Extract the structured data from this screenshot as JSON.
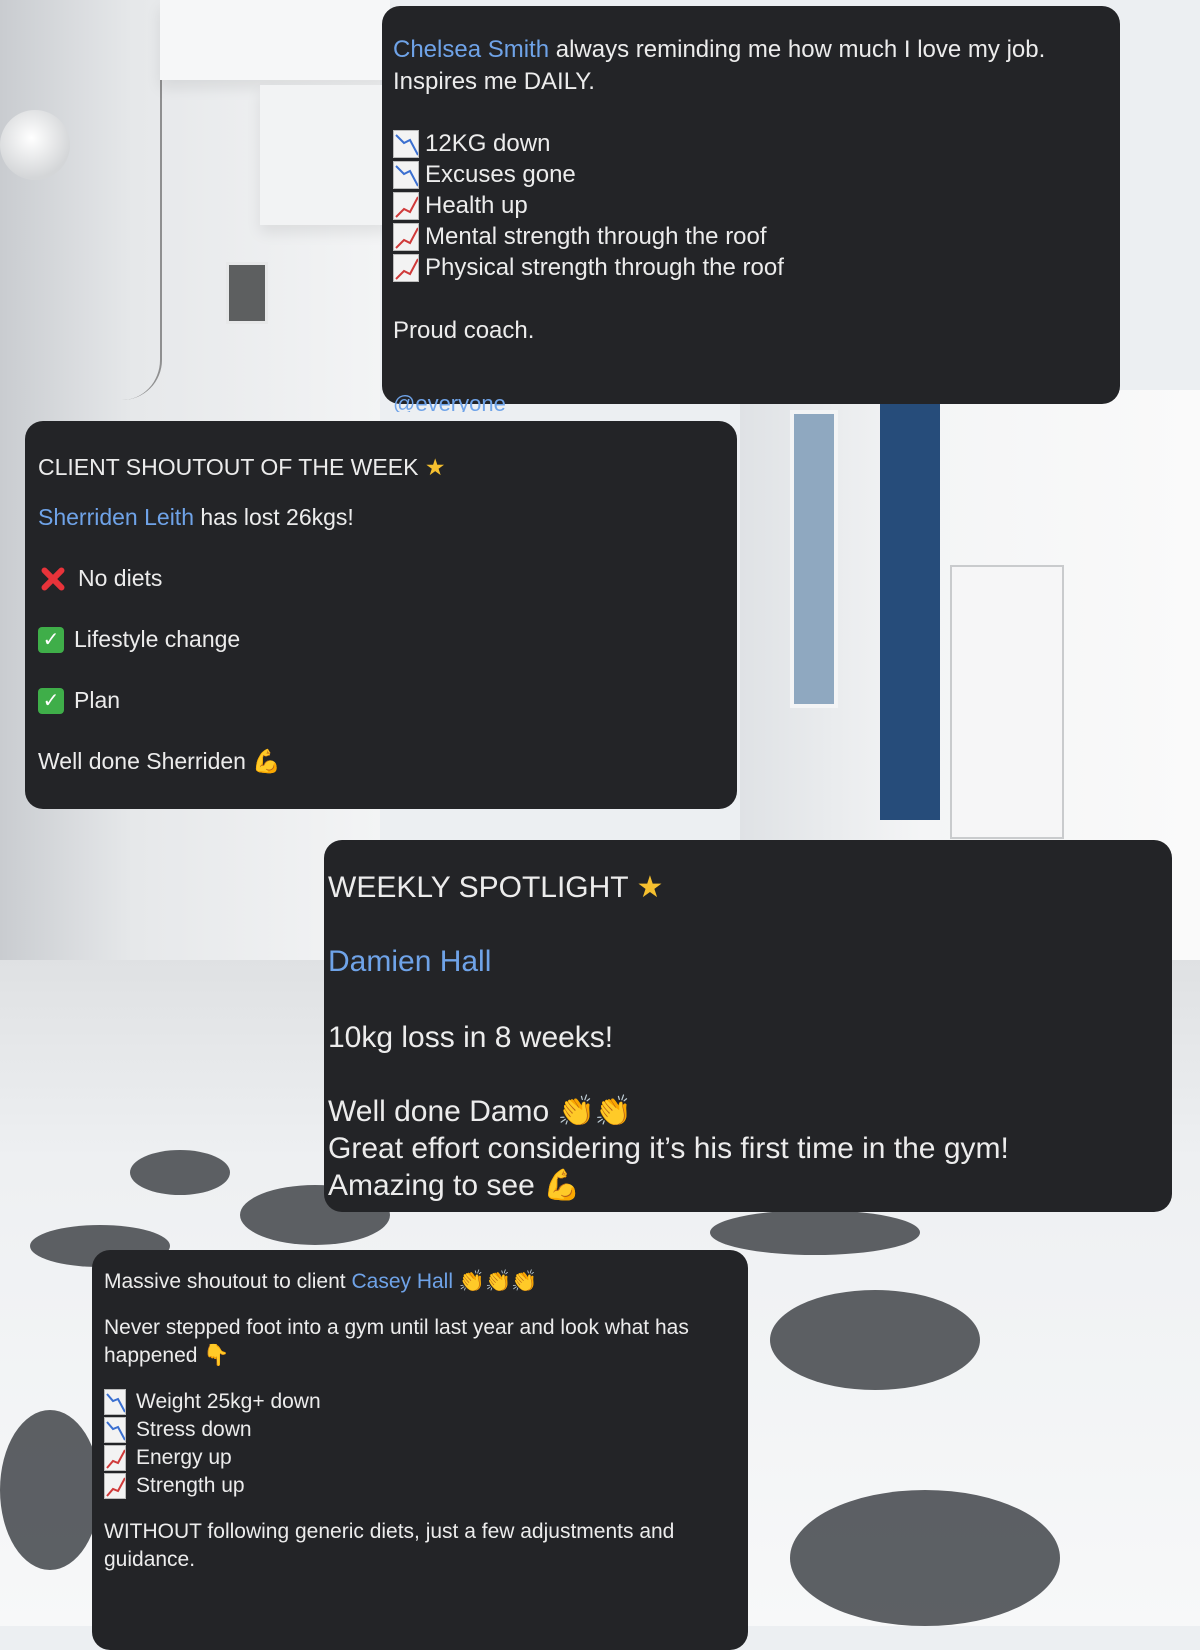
{
  "posts": [
    {
      "mention": "Chelsea Smith",
      "intro": "always reminding me how much I love my job. Inspires me DAILY.",
      "items": [
        {
          "icon": "chart-decreasing-icon",
          "text": "12KG down"
        },
        {
          "icon": "chart-decreasing-icon",
          "text": "Excuses gone"
        },
        {
          "icon": "chart-increasing-icon",
          "text": "Health up"
        },
        {
          "icon": "chart-increasing-icon",
          "text": "Mental strength through the roof"
        },
        {
          "icon": "chart-increasing-icon",
          "text": "Physical strength through the roof"
        }
      ],
      "closing": "Proud coach.",
      "tag": "@everyone"
    },
    {
      "title": "CLIENT SHOUTOUT OF THE WEEK",
      "mention": "Sherriden Leith",
      "headline": "has lost 26kgs!",
      "items": [
        {
          "icon": "cross-mark-icon",
          "text": "No diets"
        },
        {
          "icon": "check-mark-icon",
          "text": "Lifestyle change"
        },
        {
          "icon": "check-mark-icon",
          "text": "Plan"
        }
      ],
      "closing": "Well done Sherriden"
    },
    {
      "title": "WEEKLY SPOTLIGHT",
      "mention": "Damien Hall",
      "loss": "10kg loss in 8 weeks!",
      "line1": "Well done Damo",
      "line2": "Great effort considering it’s his first time in the gym!",
      "line3": "Amazing to see"
    },
    {
      "intro": "Massive shoutout to client",
      "mention": "Casey Hall",
      "para": "Never stepped foot into a gym until last year and look what has happened",
      "items": [
        {
          "icon": "chart-decreasing-icon",
          "text": "Weight 25kg+ down"
        },
        {
          "icon": "chart-decreasing-icon",
          "text": "Stress down"
        },
        {
          "icon": "chart-increasing-icon",
          "text": "Energy up"
        },
        {
          "icon": "chart-increasing-icon",
          "text": "Strength up"
        }
      ],
      "closing": "WITHOUT following generic diets, just a few adjustments and guidance."
    }
  ],
  "colors": {
    "card_bg": "#232427",
    "mention": "#6fa3e8",
    "text": "#ececec",
    "star": "#f6c02f",
    "check": "#3fae49",
    "cross": "#e8333a"
  }
}
